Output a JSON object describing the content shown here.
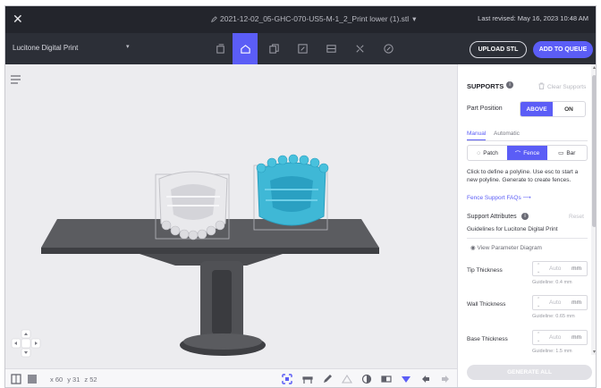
{
  "window": {
    "close_glyph": "✕",
    "filename": "2021-12-02_05-GHC-070-US5-M-1_2_Print lower (1).stl",
    "last_revised": "Last revised: May 16, 2023 10:48 AM"
  },
  "toolbar": {
    "printer": "Lucitone Digital Print",
    "caret": "▾",
    "tools": [
      "file-icon",
      "supports-icon",
      "copy-icon",
      "crop-icon",
      "layout-icon",
      "split-icon",
      "edit-icon"
    ],
    "active_tool": "supports-icon",
    "upload_label": "UPLOAD STL",
    "queue_label": "ADD TO QUEUE",
    "accent_color": "#5b5df6"
  },
  "viewport": {
    "coords": {
      "x": "x 60",
      "y": "y 31",
      "z": "z 52"
    },
    "bottom_tools": [
      "select-icon",
      "bridge-icon",
      "pencil-icon",
      "triangle-icon",
      "contrast-icon",
      "slice-icon",
      "fill-icon",
      "undo-icon",
      "redo-icon"
    ]
  },
  "panel": {
    "title": "SUPPORTS",
    "info_glyph": "i",
    "clear_label": "Clear Supports",
    "part_position_label": "Part Position",
    "above_label": "ABOVE",
    "on_label": "ON",
    "tab_manual": "Manual",
    "tab_automatic": "Automatic",
    "type_patch": "Patch",
    "type_fence": "Fence",
    "type_bar": "Bar",
    "help_text": "Click to define a polyline. Use esc to start a new polyline. Generate to create fences.",
    "faq_label": "Fence Support FAQs",
    "faq_arrow": "⟶",
    "attributes_label": "Support Attributes",
    "reset_label": "Reset",
    "guidelines_label": "Guidelines for Lucitone Digital Print",
    "view_diagram_label": "View Parameter Diagram",
    "params": [
      {
        "name": "Tip Thickness",
        "value": "Auto",
        "unit": "mm",
        "guide": "Guideline: 0.4 mm"
      },
      {
        "name": "Wall Thickness",
        "value": "Auto",
        "unit": "mm",
        "guide": "Guideline: 0.65 mm"
      },
      {
        "name": "Base Thickness",
        "value": "Auto",
        "unit": "mm",
        "guide": "Guideline: 1.5 mm"
      }
    ],
    "generate_all_label": "GENERATE ALL"
  }
}
